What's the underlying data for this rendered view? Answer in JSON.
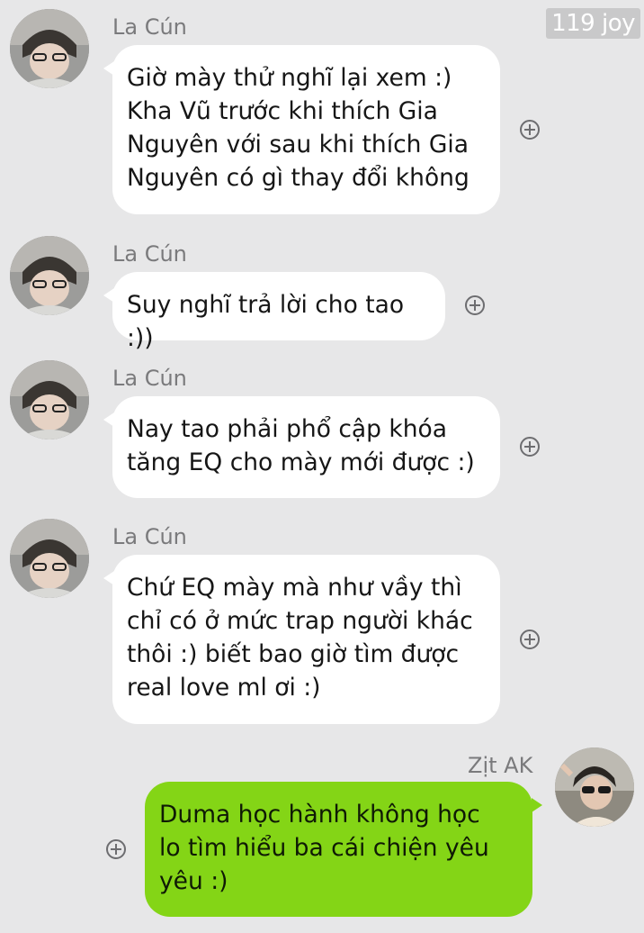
{
  "watermark": "119 joy",
  "colors": {
    "background": "#e7e7e8",
    "incoming_bubble": "#ffffff",
    "outgoing_bubble": "#84d516",
    "sender_text": "#7a7a7c"
  },
  "messages": [
    {
      "sender": "La Cún",
      "direction": "incoming",
      "lines": [
        "Giờ mày thử nghĩ lại xem :)",
        "Kha Vũ trước khi thích Gia",
        "Nguyên với sau khi thích Gia",
        "Nguyên có gì thay đổi không"
      ]
    },
    {
      "sender": "La Cún",
      "direction": "incoming",
      "lines": [
        "Suy nghĩ trả lời cho tao :))"
      ]
    },
    {
      "sender": "La Cún",
      "direction": "incoming",
      "lines": [
        "Nay tao phải phổ cập khóa",
        "tăng EQ cho mày mới được :)"
      ]
    },
    {
      "sender": "La Cún",
      "direction": "incoming",
      "lines": [
        "Chứ EQ mày mà như vầy thì",
        "chỉ có ở mức trap người khác",
        "thôi :) biết bao giờ tìm được",
        "real love ml ơi :)"
      ]
    },
    {
      "sender": "Zịt AK",
      "direction": "outgoing",
      "lines": [
        "Duma học hành không học",
        "lo tìm hiểu ba cái chiện yêu",
        "yêu :)"
      ]
    }
  ],
  "icons": {
    "react": "plus-circle-icon",
    "avatar_incoming": "avatar-la-cun",
    "avatar_outgoing": "avatar-zit-ak"
  }
}
